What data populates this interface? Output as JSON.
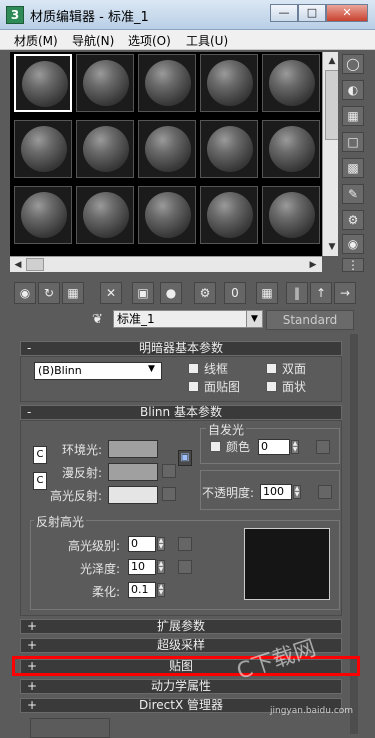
{
  "window": {
    "title": "材质编辑器 - 标准_1",
    "app_icon": "3"
  },
  "menu": [
    "材质(M)",
    "导航(N)",
    "选项(O)",
    "工具(U)"
  ],
  "toolbar": {
    "material_name": "标准_1",
    "material_type": "Standard"
  },
  "rollouts": {
    "shader": {
      "title": "明暗器基本参数",
      "shader_type": "(B)Blinn",
      "options": [
        "线框",
        "双面",
        "面贴图",
        "面状"
      ]
    },
    "blinn": {
      "title": "Blinn 基本参数",
      "ambient": "环境光:",
      "diffuse": "漫反射:",
      "specular": "高光反射:",
      "self_illum_title": "自发光",
      "color_label": "颜色",
      "color_value": "0",
      "opacity_label": "不透明度:",
      "opacity_value": "100",
      "spec_title": "反射高光",
      "spec_level_label": "高光级别:",
      "spec_level_value": "0",
      "gloss_label": "光泽度:",
      "gloss_value": "10",
      "soften_label": "柔化:",
      "soften_value": "0.1",
      "lock_icon": "lock-icon"
    },
    "collapsed": [
      "扩展参数",
      "超级采样",
      "贴图",
      "动力学属性",
      "DirectX 管理器"
    ]
  },
  "watermark": {
    "text": "C下载网",
    "sub": "jingyan.baidu.com"
  },
  "colors": {
    "ambient": "#a0a0a0",
    "diffuse": "#a0a0a0",
    "specular": "#e5e5e5",
    "highlight": "#ff0000"
  }
}
